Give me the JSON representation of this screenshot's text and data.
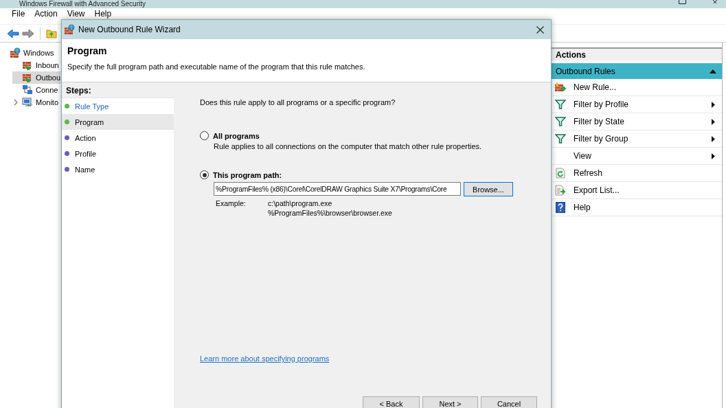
{
  "main_window": {
    "title": "Windows Firewall with Advanced Security",
    "menu": [
      "File",
      "Action",
      "View",
      "Help"
    ],
    "tree": [
      {
        "label": "Windows",
        "selected": false,
        "children": [
          {
            "label": "Inboun",
            "selected": false
          },
          {
            "label": "Outbou",
            "selected": true
          },
          {
            "label": "Conne",
            "selected": false
          },
          {
            "label": "Monito",
            "selected": false,
            "expanded": false
          }
        ]
      }
    ],
    "actions": {
      "title": "Actions",
      "section": {
        "label": "Outbound Rules",
        "expanded": true
      },
      "items": [
        {
          "label": "New Rule...",
          "submenu": false
        },
        {
          "label": "Filter by Profile",
          "submenu": true
        },
        {
          "label": "Filter by State",
          "submenu": true
        },
        {
          "label": "Filter by Group",
          "submenu": true
        },
        {
          "label": "View",
          "submenu": true
        },
        {
          "label": "Refresh",
          "submenu": false
        },
        {
          "label": "Export List...",
          "submenu": false
        },
        {
          "label": "Help",
          "submenu": false
        }
      ]
    }
  },
  "dialog": {
    "title": "New Outbound Rule Wizard",
    "heading": "Program",
    "description": "Specify the full program path and executable name of the program that this rule matches.",
    "steps_title": "Steps:",
    "steps": [
      {
        "label": "Rule Type",
        "completed": true,
        "link": true,
        "selected": false
      },
      {
        "label": "Program",
        "completed": true,
        "link": false,
        "selected": true
      },
      {
        "label": "Action",
        "completed": false,
        "link": false,
        "selected": false
      },
      {
        "label": "Profile",
        "completed": false,
        "link": false,
        "selected": false
      },
      {
        "label": "Name",
        "completed": false,
        "link": false,
        "selected": false
      }
    ],
    "question": "Does this rule apply to all programs or a specific program?",
    "options": [
      {
        "label": "All programs",
        "description": "Rule applies to all connections on the computer that match other rule properties.",
        "selected": false
      },
      {
        "label": "This program path:",
        "selected": true
      }
    ],
    "path": {
      "value": "%ProgramFiles% (x86)\\Corel\\CorelDRAW Graphics Suite X7\\Programs\\Core"
    },
    "browse_button": "Browse...",
    "example_label": "Example:",
    "examples": [
      "c:\\path\\program.exe",
      "%ProgramFiles%\\browser\\browser.exe"
    ],
    "link": "Learn more about specifying programs",
    "buttons": [
      {
        "label": "< Back",
        "focused": false
      },
      {
        "label": "Next >",
        "focused": false
      },
      {
        "label": "Cancel",
        "focused": false
      }
    ]
  }
}
